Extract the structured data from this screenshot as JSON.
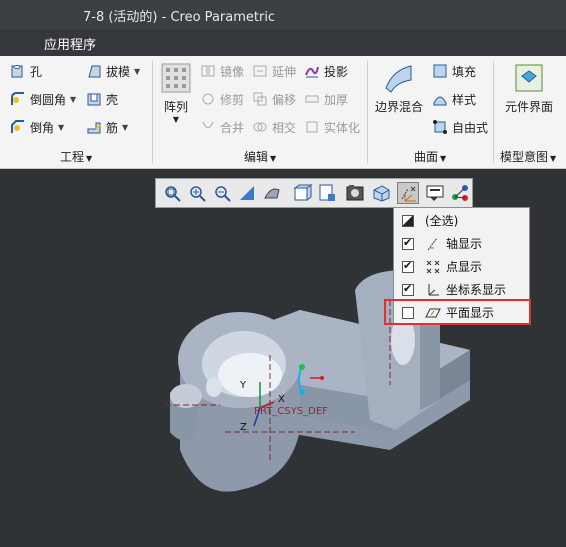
{
  "window": {
    "title": "7-8 (活动的) - Creo Parametric"
  },
  "menu": {
    "items": [
      "应用程序"
    ]
  },
  "ribbon": {
    "engineering": {
      "hole": "孔",
      "round": "倒圆角",
      "chamfer": "倒角",
      "draft": "拔模",
      "shell": "壳",
      "rib": "筋",
      "group_label": "工程"
    },
    "editing": {
      "pattern": "阵列",
      "mirror": "镜像",
      "extend": "延伸",
      "project": "投影",
      "trim": "修剪",
      "offset": "偏移",
      "thicken": "加厚",
      "merge": "合并",
      "intersect": "相交",
      "solidify": "实体化",
      "group_label": "编辑"
    },
    "surfaces": {
      "boundary_blend": "边界混合",
      "fill": "填充",
      "style": "样式",
      "freestyle": "自由式",
      "group_label": "曲面"
    },
    "model_intent": {
      "component_interface": "元件界面",
      "group_label": "模型意图"
    }
  },
  "view_toolbar": {
    "tools": [
      "refit-icon",
      "zoom-in-icon",
      "zoom-out-icon",
      "repaint-icon",
      "orient-icon",
      "saved-views-icon",
      "display-style-icon",
      "view-manager-icon",
      "perspective-icon",
      "datum-display-filter-icon",
      "annotation-display-icon",
      "spin-center-icon"
    ]
  },
  "datum_filter": {
    "items": [
      {
        "label": "(全选)",
        "state": "partial",
        "icon": "select-all-icon"
      },
      {
        "label": "轴显示",
        "state": "checked",
        "icon": "axis-display-icon"
      },
      {
        "label": "点显示",
        "state": "checked",
        "icon": "point-display-icon"
      },
      {
        "label": "坐标系显示",
        "state": "checked",
        "icon": "csys-display-icon"
      },
      {
        "label": "平面显示",
        "state": "unchecked",
        "icon": "plane-display-icon"
      }
    ]
  },
  "model": {
    "csys_label": "PRT_CSYS_DEF",
    "axis_x": "X",
    "axis_y": "Y",
    "axis_z": "Z"
  },
  "colors": {
    "highlight": "#e23030",
    "background": "#2f3336",
    "model": "#aab4c4"
  }
}
